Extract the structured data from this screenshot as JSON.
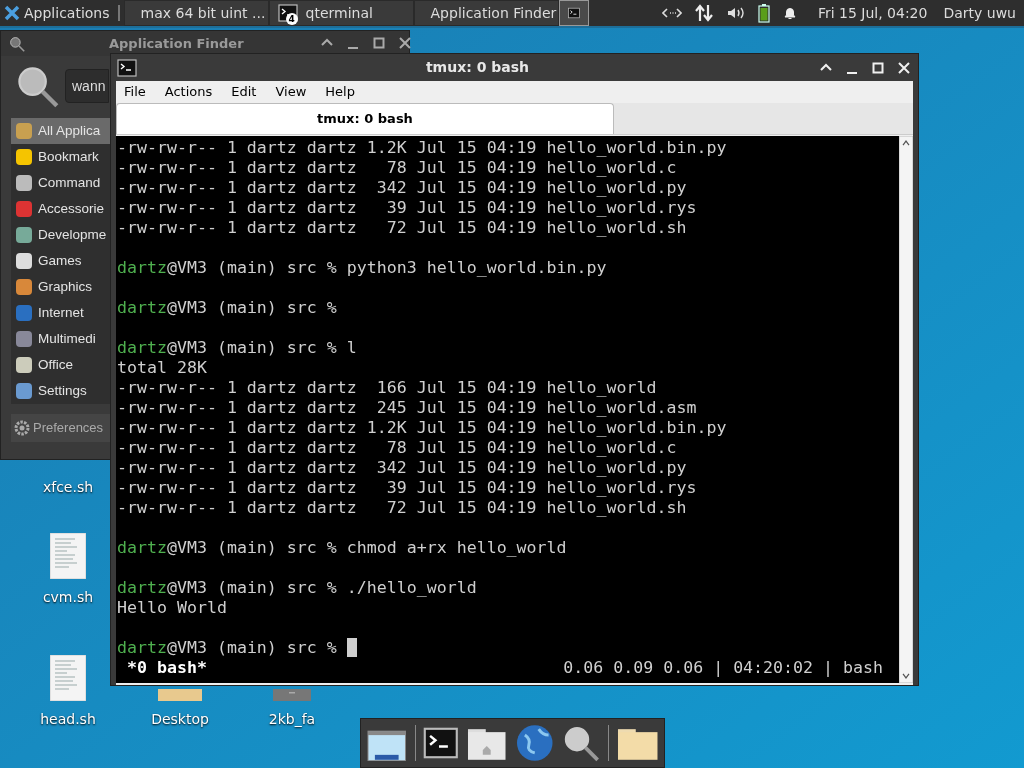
{
  "top_panel": {
    "apps_menu": "Applications",
    "tasks": [
      {
        "label": "max 64 bit uint ...",
        "kind": "browser",
        "selected": false
      },
      {
        "label": "qterminal",
        "badge": "4",
        "kind": "terminal",
        "selected": false
      },
      {
        "label": "Application Finder",
        "kind": "search",
        "selected": false
      },
      {
        "kind": "terminal",
        "selected": true
      }
    ],
    "clock": "Fri 15 Jul, 04:20",
    "user": "Darty uwu"
  },
  "desktop_icons": [
    {
      "label": "xfce.sh",
      "kind": "covered"
    },
    {
      "label": "cvm.sh",
      "kind": "script"
    },
    {
      "label": "head.sh",
      "kind": "script"
    },
    {
      "label": "Desktop",
      "kind": "folder"
    },
    {
      "label": "2kb_fa",
      "kind": "drive"
    }
  ],
  "finder": {
    "title": "Application Finder",
    "search_value": "wann",
    "categories": [
      {
        "label": "All Applica",
        "selected": true
      },
      {
        "label": "Bookmark",
        "selected": false
      },
      {
        "label": "Command",
        "selected": false
      },
      {
        "label": "Accessorie",
        "selected": false
      },
      {
        "label": "Developme",
        "selected": false
      },
      {
        "label": "Games",
        "selected": false
      },
      {
        "label": "Graphics",
        "selected": false
      },
      {
        "label": "Internet",
        "selected": false
      },
      {
        "label": "Multimedi",
        "selected": false
      },
      {
        "label": "Office",
        "selected": false
      },
      {
        "label": "Settings",
        "selected": false
      }
    ],
    "preferences_button": "Preferences"
  },
  "terminal": {
    "title": "tmux: 0 bash",
    "menu": [
      "File",
      "Actions",
      "Edit",
      "View",
      "Help"
    ],
    "tabs": [
      {
        "label": "tmux: 0 bash",
        "selected": true
      }
    ],
    "lines": [
      {
        "kind": "output",
        "text": "-rw-rw-r-- 1 dartz dartz 1.2K Jul 15 04:19 hello_world.bin.py"
      },
      {
        "kind": "output",
        "text": "-rw-rw-r-- 1 dartz dartz   78 Jul 15 04:19 hello_world.c"
      },
      {
        "kind": "output",
        "text": "-rw-rw-r-- 1 dartz dartz  342 Jul 15 04:19 hello_world.py"
      },
      {
        "kind": "output",
        "text": "-rw-rw-r-- 1 dartz dartz   39 Jul 15 04:19 hello_world.rys"
      },
      {
        "kind": "output",
        "text": "-rw-rw-r-- 1 dartz dartz   72 Jul 15 04:19 hello_world.sh"
      },
      {
        "kind": "blank"
      },
      {
        "kind": "prompt",
        "user": "dartz",
        "text": "@VM3 (main) src % python3 hello_world.bin.py"
      },
      {
        "kind": "blank"
      },
      {
        "kind": "prompt",
        "user": "dartz",
        "text": "@VM3 (main) src %"
      },
      {
        "kind": "blank"
      },
      {
        "kind": "prompt",
        "user": "dartz",
        "text": "@VM3 (main) src % l"
      },
      {
        "kind": "output",
        "text": "total 28K"
      },
      {
        "kind": "output",
        "text": "-rw-rw-r-- 1 dartz dartz  166 Jul 15 04:19 hello_world"
      },
      {
        "kind": "output",
        "text": "-rw-rw-r-- 1 dartz dartz  245 Jul 15 04:19 hello_world.asm"
      },
      {
        "kind": "output",
        "text": "-rw-rw-r-- 1 dartz dartz 1.2K Jul 15 04:19 hello_world.bin.py"
      },
      {
        "kind": "output",
        "text": "-rw-rw-r-- 1 dartz dartz   78 Jul 15 04:19 hello_world.c"
      },
      {
        "kind": "output",
        "text": "-rw-rw-r-- 1 dartz dartz  342 Jul 15 04:19 hello_world.py"
      },
      {
        "kind": "output",
        "text": "-rw-rw-r-- 1 dartz dartz   39 Jul 15 04:19 hello_world.rys"
      },
      {
        "kind": "output",
        "text": "-rw-rw-r-- 1 dartz dartz   72 Jul 15 04:19 hello_world.sh"
      },
      {
        "kind": "blank"
      },
      {
        "kind": "prompt",
        "user": "dartz",
        "text": "@VM3 (main) src % chmod a+rx hello_world"
      },
      {
        "kind": "blank"
      },
      {
        "kind": "prompt",
        "user": "dartz",
        "text": "@VM3 (main) src % ./hello_world"
      },
      {
        "kind": "output",
        "text": "Hello World"
      },
      {
        "kind": "blank"
      },
      {
        "kind": "prompt",
        "user": "dartz",
        "text": "@VM3 (main) src %",
        "cursor": true
      }
    ],
    "status_left": "*0 bash*",
    "status_right": "0.06 0.09 0.06 | 04:20:02 | bash"
  }
}
